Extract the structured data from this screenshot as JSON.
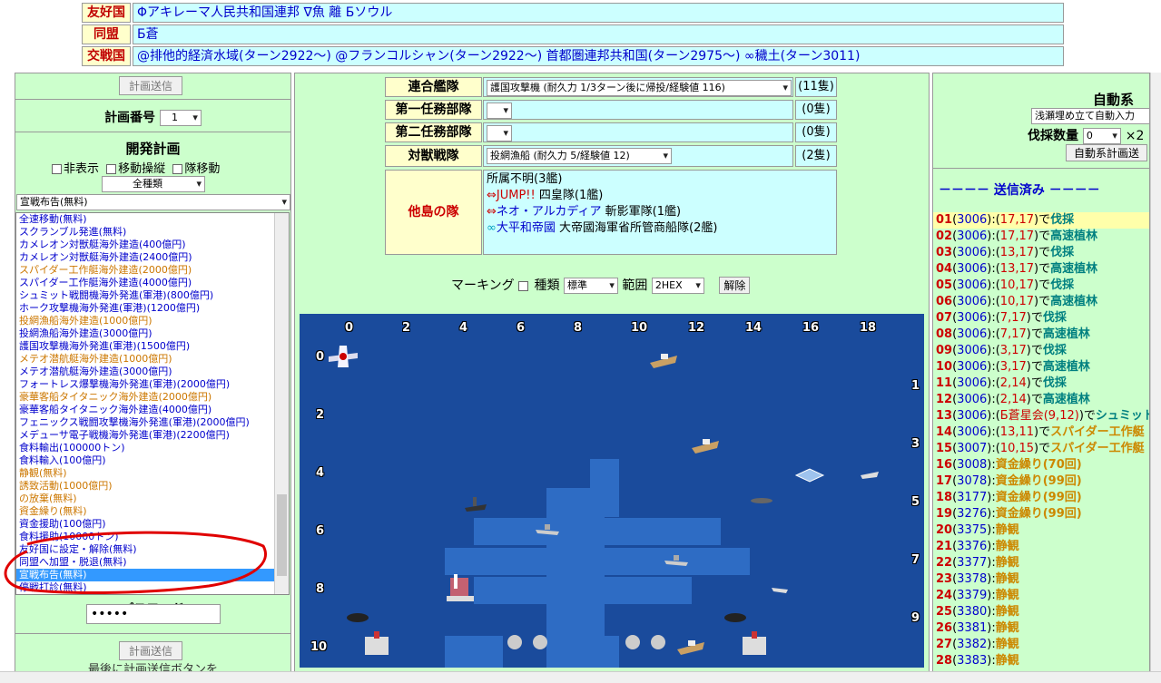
{
  "relations": {
    "friendly": {
      "label": "友好国",
      "text": "Φアキレーマ人民共和国連邦 ∇魚 離 Бソウル"
    },
    "alliance": {
      "label": "同盟",
      "text": "Б蒼"
    },
    "war": {
      "label": "交戦国",
      "text": "@排他的経済水域(ターン2922～) @フランコルシャン(ターン2922～) 首都圏連邦共和国(ターン2975～) ∞穢土(ターン3011)"
    }
  },
  "left": {
    "send_button": "計画送信",
    "plan_number_label": "計画番号",
    "plan_number_value": "1",
    "dev_plan_title": "開発計画",
    "options": {
      "hide": "非表示",
      "move_ctrl": "移動操縦",
      "team_move": "隊移動"
    },
    "category_select": "全種類",
    "command_select": "宣戦布告(無料)",
    "list": [
      {
        "t": "全速移動(無料)",
        "c": "blue"
      },
      {
        "t": "スクランブル発進(無料)",
        "c": "blue"
      },
      {
        "t": "カメレオン対獣艇海外建造(400億円)",
        "c": "blue"
      },
      {
        "t": "カメレオン対獣艇海外建造(2400億円)",
        "c": "blue"
      },
      {
        "t": "スパイダー工作艇海外建造(2000億円)",
        "c": "orange"
      },
      {
        "t": "スパイダー工作艇海外建造(4000億円)",
        "c": "blue"
      },
      {
        "t": "シュミット戦闘機海外発進(軍港)(800億円)",
        "c": "blue"
      },
      {
        "t": "ホーク攻撃機海外発進(軍港)(1200億円)",
        "c": "blue"
      },
      {
        "t": "投網漁船海外建造(1000億円)",
        "c": "orange"
      },
      {
        "t": "投網漁船海外建造(3000億円)",
        "c": "blue"
      },
      {
        "t": "護国攻撃機海外発進(軍港)(1500億円)",
        "c": "blue"
      },
      {
        "t": "メテオ潜航艇海外建造(1000億円)",
        "c": "orange"
      },
      {
        "t": "メテオ潜航艇海外建造(3000億円)",
        "c": "blue"
      },
      {
        "t": "フォートレス爆撃機海外発進(軍港)(2000億円)",
        "c": "blue"
      },
      {
        "t": "豪華客船タイタニック海外建造(2000億円)",
        "c": "orange"
      },
      {
        "t": "豪華客船タイタニック海外建造(4000億円)",
        "c": "blue"
      },
      {
        "t": "フェニックス戦闘攻撃機海外発進(軍港)(2000億円)",
        "c": "blue"
      },
      {
        "t": "メデューサ電子戦機海外発進(軍港)(2200億円)",
        "c": "blue"
      },
      {
        "t": "食料輸出(100000トン)",
        "c": "blue"
      },
      {
        "t": "食料輸入(100億円)",
        "c": "blue"
      },
      {
        "t": "静観(無料)",
        "c": "orange"
      },
      {
        "t": "誘致活動(1000億円)",
        "c": "orange"
      },
      {
        "t": "の放棄(無料)",
        "c": "orange"
      },
      {
        "t": "資金繰り(無料)",
        "c": "orange"
      },
      {
        "t": "資金援助(100億円)",
        "c": "blue"
      },
      {
        "t": "食料援助(10000トン)",
        "c": "blue"
      },
      {
        "t": "友好国に設定・解除(無料)",
        "c": "blue"
      },
      {
        "t": "同盟へ加盟・脱退(無料)",
        "c": "blue"
      },
      {
        "t": "宣戦布告(無料)",
        "c": "selected"
      },
      {
        "t": "停戦打診(無料)",
        "c": "blue"
      }
    ],
    "password_label": "パスワード",
    "password_value": "•••••",
    "send_button2": "計画送信",
    "footer_text": "最後に計画送信ボタンを"
  },
  "fleet": {
    "rows": [
      {
        "label": "連合艦隊",
        "value": "護国攻撃機 (耐久力 1/3ターン後に帰投/経験値 116)",
        "count": "(11隻)"
      },
      {
        "label": "第一任務部隊",
        "value": "",
        "count": "(0隻)"
      },
      {
        "label": "第二任務部隊",
        "value": "",
        "count": "(0隻)"
      },
      {
        "label": "対獣戦隊",
        "value": "投網漁船 (耐久力 5/経験値 12)",
        "count": "(2隻)"
      }
    ],
    "other_label": "他島の隊",
    "other_lines": {
      "l1": "所属不明(3艦)",
      "l2_sym": "⇔",
      "l2_name": "JUMP!!",
      "l2_rest": " 四皇隊(1艦)",
      "l3_sym": "⇔",
      "l3_name": "ネオ・アルカディア",
      "l3_rest": " 斬影軍隊(1艦)",
      "l4_sym": "∞",
      "l4_name": "大平和帝國",
      "l4_rest": " 大帝國海軍省所管商船隊(2艦)"
    }
  },
  "marking": {
    "label": "マーキング",
    "type_label": "種類",
    "type_value": "標準",
    "range_label": "範囲",
    "range_value": "2HEX",
    "clear_button": "解除"
  },
  "map": {
    "x_labels": [
      "0",
      "2",
      "4",
      "6",
      "8",
      "10",
      "12",
      "14",
      "16",
      "18"
    ],
    "y_left_labels": [
      "0",
      "2",
      "4",
      "6",
      "8",
      "10"
    ],
    "y_right_labels": [
      "1",
      "3",
      "5",
      "7",
      "9"
    ]
  },
  "right": {
    "auto_title": "自動系",
    "auto_select": "浅瀬埋め立て自動入力",
    "logging_label": "伐採数量",
    "logging_value": "0",
    "logging_mult": "×2",
    "auto_send": "自動系計画送",
    "sent_header": "－－－－ 送信済み －－－－",
    "log": [
      {
        "n": "01",
        "turn": "3006",
        "xy": "17,17",
        "act": "伐採",
        "gold": false
      },
      {
        "n": "02",
        "turn": "3006",
        "xy": "17,17",
        "act": "高速植林",
        "gold": false
      },
      {
        "n": "03",
        "turn": "3006",
        "xy": "13,17",
        "act": "伐採",
        "gold": false
      },
      {
        "n": "04",
        "turn": "3006",
        "xy": "13,17",
        "act": "高速植林",
        "gold": false
      },
      {
        "n": "05",
        "turn": "3006",
        "xy": "10,17",
        "act": "伐採",
        "gold": false
      },
      {
        "n": "06",
        "turn": "3006",
        "xy": "10,17",
        "act": "高速植林",
        "gold": false
      },
      {
        "n": "07",
        "turn": "3006",
        "xy": "7,17",
        "act": "伐採",
        "gold": false
      },
      {
        "n": "08",
        "turn": "3006",
        "xy": "7,17",
        "act": "高速植林",
        "gold": false
      },
      {
        "n": "09",
        "turn": "3006",
        "xy": "3,17",
        "act": "伐採",
        "gold": false
      },
      {
        "n": "10",
        "turn": "3006",
        "xy": "3,17",
        "act": "高速植林",
        "gold": false
      },
      {
        "n": "11",
        "turn": "3006",
        "xy": "2,14",
        "act": "伐採",
        "gold": false
      },
      {
        "n": "12",
        "turn": "3006",
        "xy": "2,14",
        "act": "高速植林",
        "gold": false
      },
      {
        "n": "13",
        "turn": "3006",
        "xy": "Б蒼星会(9,12)",
        "act": "シュミット戦",
        "gold": false
      },
      {
        "n": "14",
        "turn": "3006",
        "xy": "13,11",
        "act": "スパイダー工作艇",
        "gold": true
      },
      {
        "n": "15",
        "turn": "3007",
        "xy": "10,15",
        "act": "スパイダー工作艇",
        "gold": true
      },
      {
        "n": "16",
        "turn": "3008",
        "xy": "",
        "act": "資金繰り(70回)",
        "gold": true
      },
      {
        "n": "17",
        "turn": "3078",
        "xy": "",
        "act": "資金繰り(99回)",
        "gold": true
      },
      {
        "n": "18",
        "turn": "3177",
        "xy": "",
        "act": "資金繰り(99回)",
        "gold": true
      },
      {
        "n": "19",
        "turn": "3276",
        "xy": "",
        "act": "資金繰り(99回)",
        "gold": true
      },
      {
        "n": "20",
        "turn": "3375",
        "xy": "",
        "act": "静観",
        "gold": true
      },
      {
        "n": "21",
        "turn": "3376",
        "xy": "",
        "act": "静観",
        "gold": true
      },
      {
        "n": "22",
        "turn": "3377",
        "xy": "",
        "act": "静観",
        "gold": true
      },
      {
        "n": "23",
        "turn": "3378",
        "xy": "",
        "act": "静観",
        "gold": true
      },
      {
        "n": "24",
        "turn": "3379",
        "xy": "",
        "act": "静観",
        "gold": true
      },
      {
        "n": "25",
        "turn": "3380",
        "xy": "",
        "act": "静観",
        "gold": true
      },
      {
        "n": "26",
        "turn": "3381",
        "xy": "",
        "act": "静観",
        "gold": true
      },
      {
        "n": "27",
        "turn": "3382",
        "xy": "",
        "act": "静観",
        "gold": true
      },
      {
        "n": "28",
        "turn": "3383",
        "xy": "",
        "act": "静観",
        "gold": true
      }
    ]
  },
  "colors": {
    "panel_green": "#ccffcc",
    "header_cyan": "#ccffff",
    "label_yellow": "#ffffcc",
    "sea_deep": "#1a4b9c",
    "sea_shallow": "#2e6cc4",
    "annotation_red": "#e00000"
  }
}
